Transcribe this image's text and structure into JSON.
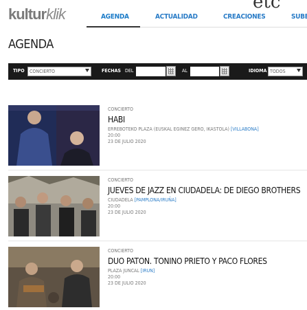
{
  "header": {
    "logo_main": "kultur",
    "logo_italic": "klik",
    "overlay_text": "etc"
  },
  "nav": {
    "items": [
      {
        "label": "AGENDA"
      },
      {
        "label": "ACTUALIDAD"
      },
      {
        "label": "CREACIONES"
      },
      {
        "label": "SUBE"
      }
    ]
  },
  "page_title": "AGENDA",
  "filters": {
    "tipo_label": "TIPO",
    "tipo_value": "CONCIERTO",
    "fechas_label": "FECHAS",
    "del_label": "DEL",
    "al_label": "AL",
    "idioma_label": "IDIOMA",
    "idioma_value": "TODOS"
  },
  "events": [
    {
      "category": "CONCIERTO",
      "title": "HABI",
      "place": "ERREBOTEKO PLAZA (EUSKAL EGINEZ GERO, IKASTOLA)",
      "town": "[VILLABONA]",
      "time": "20:00",
      "date": "23 DE JULIO 2020"
    },
    {
      "category": "CONCIERTO",
      "title": "JUEVES DE JAZZ EN CIUDADELA: DE DIEGO BROTHERS",
      "place": "CIUDADELA",
      "town": "[PAMPLONA/IRUÑA]",
      "time": "20:00",
      "date": "23 DE JULIO 2020"
    },
    {
      "category": "CONCIERTO",
      "title": "DUO PATON. TONINO PRIETO Y PACO FLORES",
      "place": "PLAZA JUNCAL",
      "town": "[IRUN]",
      "time": "20:00",
      "date": "23 DE JULIO 2020"
    }
  ],
  "colors": {
    "link_blue": "#2a7cc7",
    "filter_bar_bg": "#1a1a1a"
  }
}
